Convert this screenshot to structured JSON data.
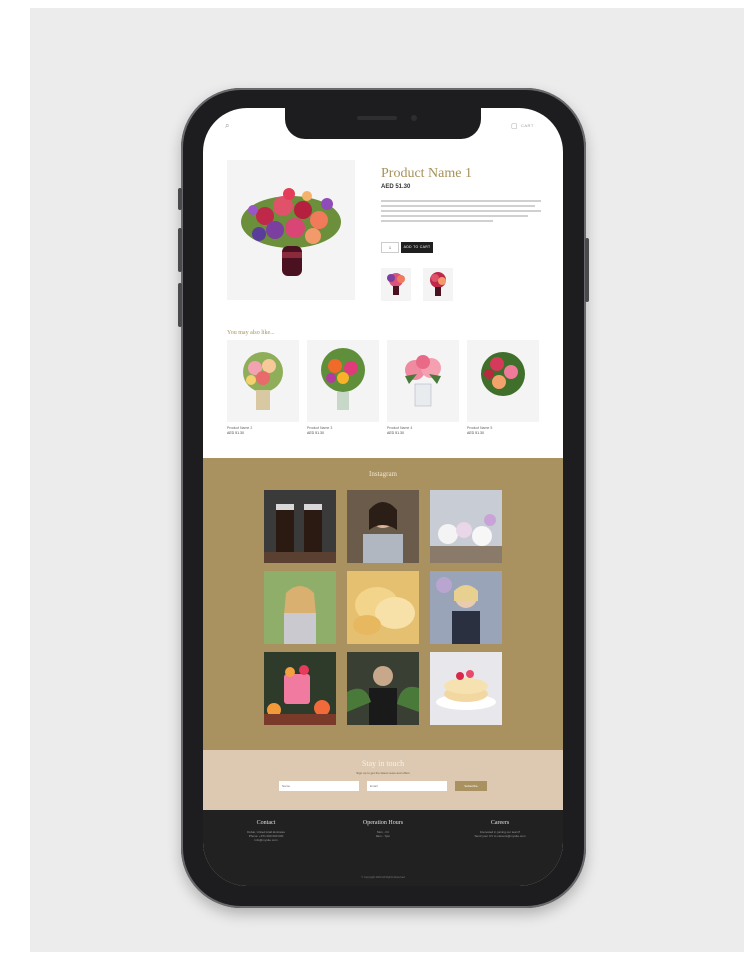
{
  "product": {
    "title": "Product Name 1",
    "price": "AED 51.30",
    "quantity": "1",
    "add_button": "ADD TO CART"
  },
  "header": {
    "cart_label": "CART"
  },
  "related": {
    "title": "You may also like...",
    "items": [
      {
        "name": "Product Name 2",
        "price": "AED 51.30"
      },
      {
        "name": "Product Name 3",
        "price": "AED 51.30"
      },
      {
        "name": "Product Name 4",
        "price": "AED 51.30"
      },
      {
        "name": "Product Name 5",
        "price": "AED 51.30"
      }
    ]
  },
  "gallery": {
    "title": "Instagram"
  },
  "newsletter": {
    "title": "Stay in touch",
    "subtitle": "Sign up to get the latest news and offers",
    "name_placeholder": "Name",
    "email_placeholder": "Email",
    "submit": "Subscribe"
  },
  "footer": {
    "contact": {
      "title": "Contact",
      "lines": [
        "Dubai, United Arab Emirates",
        "Phone: +971 000 000 000",
        "info@mysite.com"
      ]
    },
    "hours": {
      "title": "Operation Hours",
      "lines": [
        "Mon - Fri",
        "9am - 7pm"
      ]
    },
    "careers": {
      "title": "Careers",
      "lines": [
        "Interested in joining our team?",
        "Send your CV to careers@mysite.com"
      ]
    },
    "copyright": "© Copyright 2023 All Rights Reserved"
  },
  "colors": {
    "gold": "#a99160",
    "sand": "#ddc9b1",
    "footer": "#212121"
  }
}
